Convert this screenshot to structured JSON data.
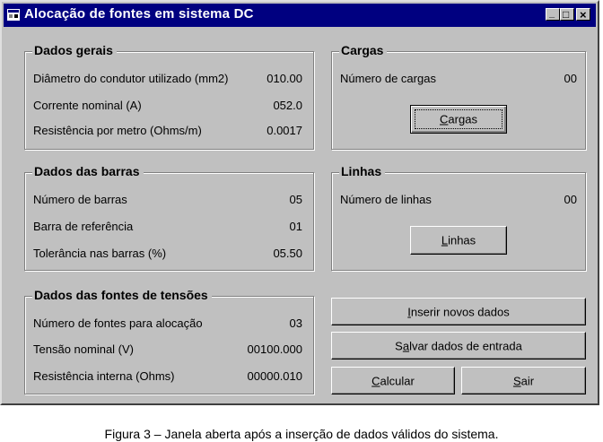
{
  "window": {
    "title": "Alocação de fontes em sistema DC",
    "controls": {
      "minimize": "_",
      "maximize": "□",
      "close": "×"
    }
  },
  "dados_gerais": {
    "legend": "Dados gerais",
    "rows": [
      {
        "label": "Diâmetro do condutor utilizado (mm2)",
        "value": "010.00"
      },
      {
        "label": "Corrente nominal (A)",
        "value": "052.0"
      },
      {
        "label": "Resistência por metro (Ohms/m)",
        "value": "0.0017"
      }
    ]
  },
  "dados_barras": {
    "legend": "Dados das barras",
    "rows": [
      {
        "label": "Número de barras",
        "value": "05"
      },
      {
        "label": "Barra de referência",
        "value": "01"
      },
      {
        "label": "Tolerância nas barras (%)",
        "value": "05.50"
      }
    ]
  },
  "dados_fontes": {
    "legend": "Dados das fontes de tensões",
    "rows": [
      {
        "label": "Número de fontes para alocação",
        "value": "03"
      },
      {
        "label": "Tensão nominal (V)",
        "value": "00100.000"
      },
      {
        "label": "Resistência interna (Ohms)",
        "value": "00000.010"
      }
    ]
  },
  "cargas": {
    "legend": "Cargas",
    "label": "Número de cargas",
    "value": "00",
    "button": {
      "hotkey": "C",
      "rest": "argas"
    }
  },
  "linhas": {
    "legend": "Linhas",
    "label": "Número de linhas",
    "value": "00",
    "button": {
      "hotkey": "L",
      "rest": "inhas"
    }
  },
  "actions": {
    "inserir": {
      "hotkey": "I",
      "rest": "nserir novos dados"
    },
    "salvar": {
      "pre": "S",
      "hotkey": "a",
      "rest": "lvar dados de entrada"
    },
    "calcular": {
      "hotkey": "C",
      "rest": "alcular"
    },
    "sair": {
      "hotkey": "S",
      "rest": "air"
    }
  },
  "caption": "Figura 3 – Janela aberta após a inserção de dados válidos do sistema."
}
